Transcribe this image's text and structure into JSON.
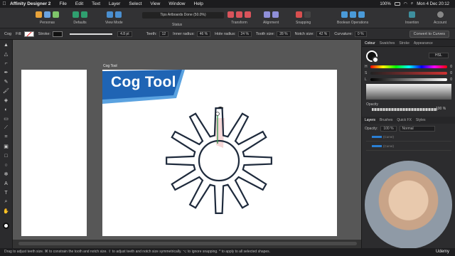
{
  "menubar": {
    "app_name": "Affinity Designer 2",
    "items": [
      "File",
      "Edit",
      "Text",
      "Layer",
      "Select",
      "View",
      "Window",
      "Help"
    ],
    "clock": "Mon 4 Dec 20:12",
    "battery": "100%"
  },
  "toolbar": {
    "personas_label": "Personas",
    "defaults_label": "Defaults",
    "viewmode_label": "View Mode",
    "status_text": "Tips Artboards Done (50.0%)",
    "status_label": "Status",
    "transform_label": "Transform",
    "alignment_label": "Alignment",
    "snapping_label": "Snapping",
    "boolean_label": "Boolean Operations",
    "insertion_label": "Insertion",
    "account_label": "Account"
  },
  "context": {
    "tool_name": "Cog",
    "fill_label": "Fill:",
    "stroke_label": "Stroke:",
    "stroke_width": "4.8 pt",
    "teeth_label": "Teeth:",
    "teeth_value": "12",
    "inner_radius_label": "Inner radius:",
    "inner_radius_value": "46 %",
    "hole_radius_label": "Hole radius:",
    "hole_radius_value": "24 %",
    "tooth_size_label": "Tooth size:",
    "tooth_size_value": "28 %",
    "notch_size_label": "Notch size:",
    "notch_size_value": "42 %",
    "curvature_label": "Curvature:",
    "curvature_value": "0 %",
    "convert_label": "Convert to Curves"
  },
  "canvas": {
    "artboard_label": "Cog Tool",
    "banner_text": "Cog Tool",
    "banner_color": "#1f64b4",
    "cog_stroke_color": "#1e2a3c"
  },
  "colour_panel": {
    "tabs": [
      "Colour",
      "Swatches",
      "Stroke",
      "Appearance"
    ],
    "mode": "HSL",
    "h_label": "H",
    "s_label": "S",
    "l_label": "L",
    "h_value": "0",
    "s_value": "0",
    "l_value": "0",
    "opacity_label": "Opacity",
    "opacity_value": "100 %"
  },
  "layers_panel": {
    "tabs": [
      "Layers",
      "Brushes",
      "Quick FX",
      "Styles"
    ],
    "opacity_label": "Opacity:",
    "opacity_value": "100 %",
    "blend_mode": "Normal",
    "layer_names": [
      "(Curve)",
      "(Curve)"
    ]
  },
  "statusbar": {
    "hint": "Drag to adjust teeth size. ⌘ to constrain the tooth and notch size. ⇧ to adjust teeth and notch size symmetrically. ⌥ to ignore snapping. ^ to apply to all selected shapes."
  },
  "watermark": "Udemy"
}
